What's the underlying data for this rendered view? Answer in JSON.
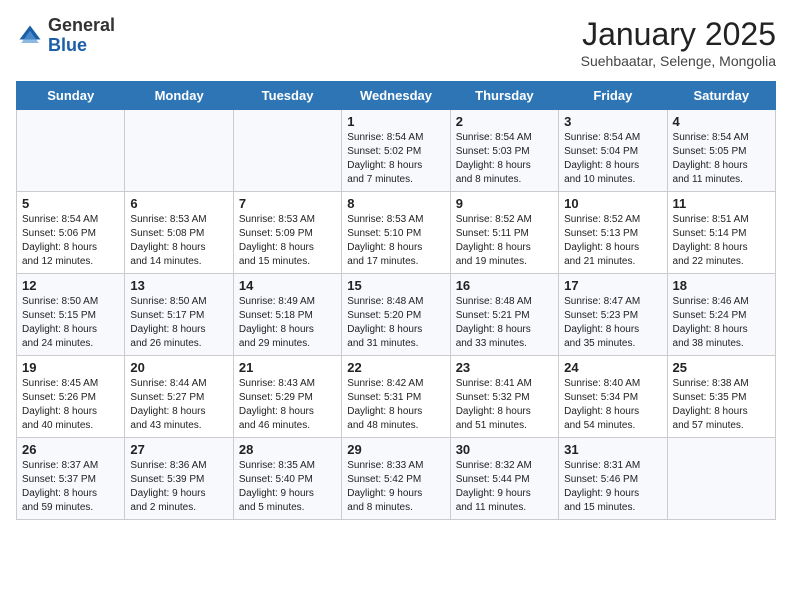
{
  "header": {
    "logo": {
      "general": "General",
      "blue": "Blue"
    },
    "title": "January 2025",
    "subtitle": "Suehbaatar, Selenge, Mongolia"
  },
  "days_of_week": [
    "Sunday",
    "Monday",
    "Tuesday",
    "Wednesday",
    "Thursday",
    "Friday",
    "Saturday"
  ],
  "weeks": [
    [
      {
        "day": "",
        "info": ""
      },
      {
        "day": "",
        "info": ""
      },
      {
        "day": "",
        "info": ""
      },
      {
        "day": "1",
        "info": "Sunrise: 8:54 AM\nSunset: 5:02 PM\nDaylight: 8 hours\nand 7 minutes."
      },
      {
        "day": "2",
        "info": "Sunrise: 8:54 AM\nSunset: 5:03 PM\nDaylight: 8 hours\nand 8 minutes."
      },
      {
        "day": "3",
        "info": "Sunrise: 8:54 AM\nSunset: 5:04 PM\nDaylight: 8 hours\nand 10 minutes."
      },
      {
        "day": "4",
        "info": "Sunrise: 8:54 AM\nSunset: 5:05 PM\nDaylight: 8 hours\nand 11 minutes."
      }
    ],
    [
      {
        "day": "5",
        "info": "Sunrise: 8:54 AM\nSunset: 5:06 PM\nDaylight: 8 hours\nand 12 minutes."
      },
      {
        "day": "6",
        "info": "Sunrise: 8:53 AM\nSunset: 5:08 PM\nDaylight: 8 hours\nand 14 minutes."
      },
      {
        "day": "7",
        "info": "Sunrise: 8:53 AM\nSunset: 5:09 PM\nDaylight: 8 hours\nand 15 minutes."
      },
      {
        "day": "8",
        "info": "Sunrise: 8:53 AM\nSunset: 5:10 PM\nDaylight: 8 hours\nand 17 minutes."
      },
      {
        "day": "9",
        "info": "Sunrise: 8:52 AM\nSunset: 5:11 PM\nDaylight: 8 hours\nand 19 minutes."
      },
      {
        "day": "10",
        "info": "Sunrise: 8:52 AM\nSunset: 5:13 PM\nDaylight: 8 hours\nand 21 minutes."
      },
      {
        "day": "11",
        "info": "Sunrise: 8:51 AM\nSunset: 5:14 PM\nDaylight: 8 hours\nand 22 minutes."
      }
    ],
    [
      {
        "day": "12",
        "info": "Sunrise: 8:50 AM\nSunset: 5:15 PM\nDaylight: 8 hours\nand 24 minutes."
      },
      {
        "day": "13",
        "info": "Sunrise: 8:50 AM\nSunset: 5:17 PM\nDaylight: 8 hours\nand 26 minutes."
      },
      {
        "day": "14",
        "info": "Sunrise: 8:49 AM\nSunset: 5:18 PM\nDaylight: 8 hours\nand 29 minutes."
      },
      {
        "day": "15",
        "info": "Sunrise: 8:48 AM\nSunset: 5:20 PM\nDaylight: 8 hours\nand 31 minutes."
      },
      {
        "day": "16",
        "info": "Sunrise: 8:48 AM\nSunset: 5:21 PM\nDaylight: 8 hours\nand 33 minutes."
      },
      {
        "day": "17",
        "info": "Sunrise: 8:47 AM\nSunset: 5:23 PM\nDaylight: 8 hours\nand 35 minutes."
      },
      {
        "day": "18",
        "info": "Sunrise: 8:46 AM\nSunset: 5:24 PM\nDaylight: 8 hours\nand 38 minutes."
      }
    ],
    [
      {
        "day": "19",
        "info": "Sunrise: 8:45 AM\nSunset: 5:26 PM\nDaylight: 8 hours\nand 40 minutes."
      },
      {
        "day": "20",
        "info": "Sunrise: 8:44 AM\nSunset: 5:27 PM\nDaylight: 8 hours\nand 43 minutes."
      },
      {
        "day": "21",
        "info": "Sunrise: 8:43 AM\nSunset: 5:29 PM\nDaylight: 8 hours\nand 46 minutes."
      },
      {
        "day": "22",
        "info": "Sunrise: 8:42 AM\nSunset: 5:31 PM\nDaylight: 8 hours\nand 48 minutes."
      },
      {
        "day": "23",
        "info": "Sunrise: 8:41 AM\nSunset: 5:32 PM\nDaylight: 8 hours\nand 51 minutes."
      },
      {
        "day": "24",
        "info": "Sunrise: 8:40 AM\nSunset: 5:34 PM\nDaylight: 8 hours\nand 54 minutes."
      },
      {
        "day": "25",
        "info": "Sunrise: 8:38 AM\nSunset: 5:35 PM\nDaylight: 8 hours\nand 57 minutes."
      }
    ],
    [
      {
        "day": "26",
        "info": "Sunrise: 8:37 AM\nSunset: 5:37 PM\nDaylight: 8 hours\nand 59 minutes."
      },
      {
        "day": "27",
        "info": "Sunrise: 8:36 AM\nSunset: 5:39 PM\nDaylight: 9 hours\nand 2 minutes."
      },
      {
        "day": "28",
        "info": "Sunrise: 8:35 AM\nSunset: 5:40 PM\nDaylight: 9 hours\nand 5 minutes."
      },
      {
        "day": "29",
        "info": "Sunrise: 8:33 AM\nSunset: 5:42 PM\nDaylight: 9 hours\nand 8 minutes."
      },
      {
        "day": "30",
        "info": "Sunrise: 8:32 AM\nSunset: 5:44 PM\nDaylight: 9 hours\nand 11 minutes."
      },
      {
        "day": "31",
        "info": "Sunrise: 8:31 AM\nSunset: 5:46 PM\nDaylight: 9 hours\nand 15 minutes."
      },
      {
        "day": "",
        "info": ""
      }
    ]
  ]
}
